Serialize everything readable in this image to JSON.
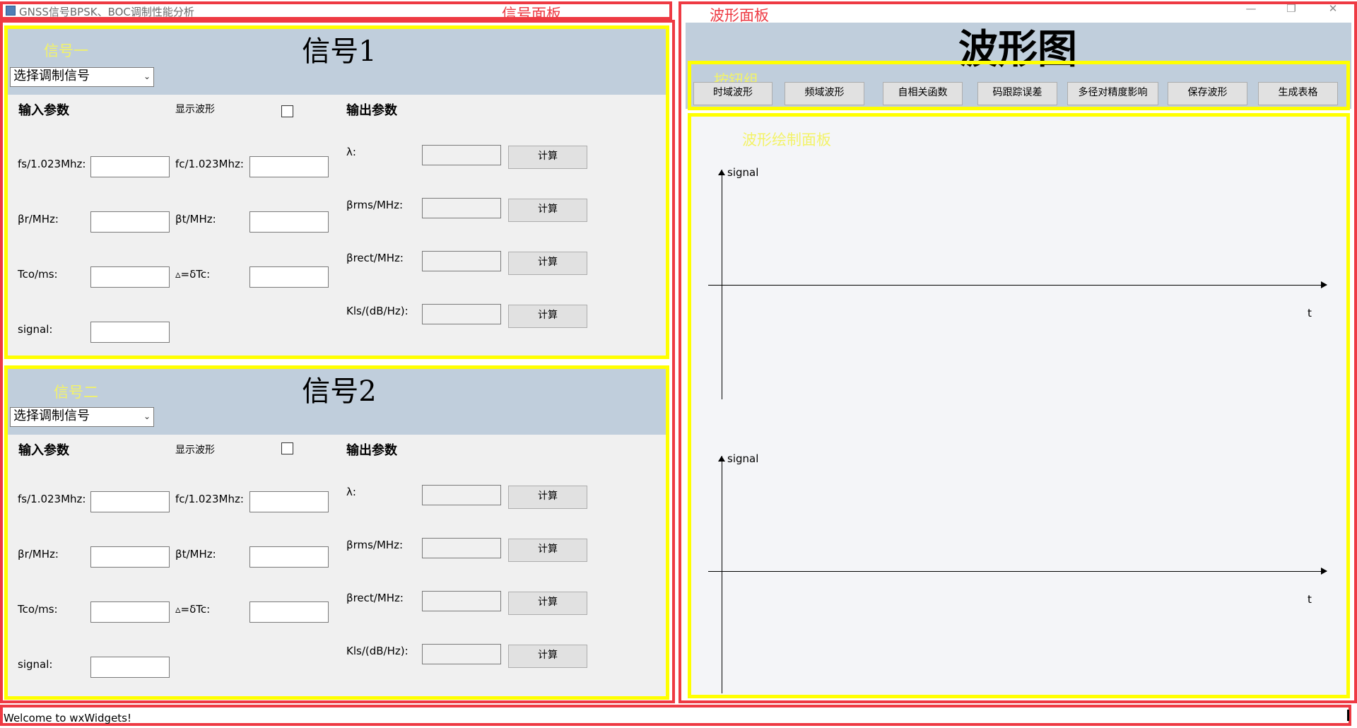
{
  "window": {
    "title": "GNSS信号BPSK、BOC调制性能分析"
  },
  "annotations": {
    "signal_panel": "信号面板",
    "wave_panel": "波形面板",
    "signal1_tag": "信号一",
    "signal2_tag": "信号二",
    "button_group": "按钮组",
    "draw_panel": "波形绘制面板"
  },
  "signal1": {
    "title": "信号1",
    "select": "选择调制信号",
    "input_header": "输入参数",
    "show_wave": "显示波形",
    "output_header": "输出参数",
    "inputs": [
      {
        "label": "fs/1.023Mhz:",
        "value": ""
      },
      {
        "label": "fc/1.023Mhz:",
        "value": ""
      },
      {
        "label": "βr/MHz:",
        "value": ""
      },
      {
        "label": "βt/MHz:",
        "value": ""
      },
      {
        "label": "Tco/ms:",
        "value": ""
      },
      {
        "label": "▵=δTc:",
        "value": ""
      },
      {
        "label": "signal:",
        "value": ""
      }
    ],
    "outputs": [
      {
        "label": "λ:",
        "value": "",
        "button": "计算"
      },
      {
        "label": "βrms/MHz:",
        "value": "",
        "button": "计算"
      },
      {
        "label": "βrect/MHz:",
        "value": "",
        "button": "计算"
      },
      {
        "label": "Kls/(dB/Hz):",
        "value": "",
        "button": "计算"
      }
    ]
  },
  "signal2": {
    "title": "信号2",
    "select": "选择调制信号",
    "input_header": "输入参数",
    "show_wave": "显示波形",
    "output_header": "输出参数",
    "inputs": [
      {
        "label": "fs/1.023Mhz:",
        "value": ""
      },
      {
        "label": "fc/1.023Mhz:",
        "value": ""
      },
      {
        "label": "βr/MHz:",
        "value": ""
      },
      {
        "label": "βt/MHz:",
        "value": ""
      },
      {
        "label": "Tco/ms:",
        "value": ""
      },
      {
        "label": "▵=δTc:",
        "value": ""
      },
      {
        "label": "signal:",
        "value": ""
      }
    ],
    "outputs": [
      {
        "label": "λ:",
        "value": "",
        "button": "计算"
      },
      {
        "label": "βrms/MHz:",
        "value": "",
        "button": "计算"
      },
      {
        "label": "βrect/MHz:",
        "value": "",
        "button": "计算"
      },
      {
        "label": "Kls/(dB/Hz):",
        "value": "",
        "button": "计算"
      }
    ]
  },
  "wave": {
    "title": "波形图",
    "buttons": [
      "时域波形",
      "频域波形",
      "自相关函数",
      "码跟踪误差",
      "多径对精度影响",
      "保存波形",
      "生成表格"
    ],
    "plot1": {
      "y_label": "signal",
      "x_label": "t"
    },
    "plot2": {
      "y_label": "signal",
      "x_label": "t"
    }
  },
  "status": {
    "text": "Welcome to wxWidgets!"
  },
  "colors": {
    "annotation_red": "#ee3a43",
    "annotation_yellow": "#ffff00",
    "panel_header": "#c0cedc"
  }
}
